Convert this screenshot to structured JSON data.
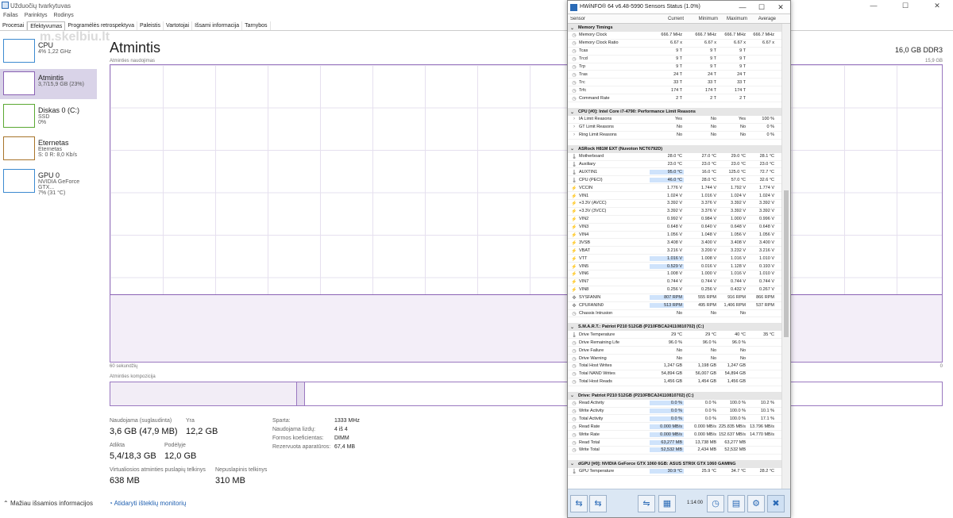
{
  "tm": {
    "title": "Užduočių tvarkytuvas",
    "win_min": "—",
    "win_max": "☐",
    "win_close": "✕",
    "menu": [
      "Failas",
      "Parinktys",
      "Rodinys"
    ],
    "tabs": [
      "Procesai",
      "Efektyvumas",
      "Programėlės retrospektyva",
      "Paleistis",
      "Vartotojai",
      "Išsami informacija",
      "Tarnybos"
    ],
    "watermark": "m.skelbiu.lt",
    "sidebar": [
      {
        "name": "CPU",
        "sub1": "4% 1,22 GHz",
        "sub2": ""
      },
      {
        "name": "Atmintis",
        "sub1": "3,7/15,9 GB (23%)",
        "sub2": ""
      },
      {
        "name": "Diskas 0 (C:)",
        "sub1": "SSD",
        "sub2": "0%"
      },
      {
        "name": "Eternetas",
        "sub1": "Eternetas",
        "sub2": "S: 0 R: 8,0 Kb/s"
      },
      {
        "name": "GPU 0",
        "sub1": "NVIDIA GeForce GTX...",
        "sub2": "7% (31 °C)"
      }
    ],
    "heading": "Atmintis",
    "mem_size": "16,0 GB DDR3",
    "chart_label": "Atminties naudojimas",
    "chart_max": "15,9 GB",
    "sec_label": "60 sekundžių",
    "zero": "0",
    "comp_label": "Atminties kompozicija",
    "stats": [
      {
        "label": "Naudojama (suglaudinta)",
        "value": "3,6 GB (47,9 MB)"
      },
      {
        "label": "Yra",
        "value": "12,2 GB"
      },
      {
        "label": "Atlikta",
        "value": "5,4/18,3 GB"
      },
      {
        "label": "Podėlyje",
        "value": "12,0 GB"
      },
      {
        "label": "Virtualiosios atminties puslapių telkinys",
        "value": "638 MB"
      },
      {
        "label": "Nepuslapinis telkinys",
        "value": "310 MB"
      }
    ],
    "kv": [
      {
        "k": "Sparta:",
        "v": "1333 MHz"
      },
      {
        "k": "Naudojama lizdų:",
        "v": "4 iš 4"
      },
      {
        "k": "Formos koeficientas:",
        "v": "DIMM"
      },
      {
        "k": "Rezervuota aparatūros:",
        "v": "67,4 MB"
      }
    ],
    "footer": {
      "less": "Mažiau išsamios informacijos",
      "monitor": "Atidaryti išteklių monitorių"
    }
  },
  "hw": {
    "title": "HWiNFO® 64 v6.48-5990 Sensors Status (1.0%)",
    "win_min": "—",
    "win_max": "☐",
    "win_close": "✕",
    "headers": [
      "Sensor",
      "Current",
      "Minimum",
      "Maximum",
      "Average"
    ],
    "groups": [
      {
        "name": "Memory Timings",
        "rows": [
          [
            "c",
            "Memory Clock",
            "666.7 MHz",
            "666.7 MHz",
            "666.7 MHz",
            "666.7 MHz",
            0
          ],
          [
            "c",
            "Memory Clock Ratio",
            "6.67 x",
            "6.67 x",
            "6.67 x",
            "6.67 x",
            0
          ],
          [
            "c",
            "Tcas",
            "9 T",
            "9 T",
            "9 T",
            "",
            0
          ],
          [
            "c",
            "Trcd",
            "9 T",
            "9 T",
            "9 T",
            "",
            0
          ],
          [
            "c",
            "Trp",
            "9 T",
            "9 T",
            "9 T",
            "",
            0
          ],
          [
            "c",
            "Tras",
            "24 T",
            "24 T",
            "24 T",
            "",
            0
          ],
          [
            "c",
            "Trc",
            "33 T",
            "33 T",
            "33 T",
            "",
            0
          ],
          [
            "c",
            "Trfc",
            "174 T",
            "174 T",
            "174 T",
            "",
            0
          ],
          [
            "c",
            "Command Rate",
            "2 T",
            "2 T",
            "2 T",
            "",
            0
          ]
        ]
      },
      {
        "name": "CPU [#0]: Intel Core i7-4790: Performance Limit Reasons",
        "rows": [
          [
            "x",
            "IA Limit Reasons",
            "Yes",
            "No",
            "Yes",
            "100 %",
            0
          ],
          [
            "x",
            "GT Limit Reasons",
            "No",
            "No",
            "No",
            "0 %",
            0
          ],
          [
            "x",
            "Ring Limit Reasons",
            "No",
            "No",
            "No",
            "0 %",
            0
          ]
        ]
      },
      {
        "name": "ASRock H81M EXT (Nuvoton NCT6792D)",
        "rows": [
          [
            "t",
            "Motherboard",
            "28.0 °C",
            "27.0 °C",
            "29.0 °C",
            "28.1 °C",
            0
          ],
          [
            "t",
            "Auxiliary",
            "23.0 °C",
            "23.0 °C",
            "23.0 °C",
            "23.0 °C",
            0
          ],
          [
            "t",
            "AUXTIN1",
            "95.0 °C",
            "16.0 °C",
            "125.0 °C",
            "72.7 °C",
            1
          ],
          [
            "t",
            "CPU (PECI)",
            "46.0 °C",
            "28.0 °C",
            "57.0 °C",
            "32.6 °C",
            1
          ],
          [
            "v",
            "VCCIN",
            "1.776 V",
            "1.744 V",
            "1.792 V",
            "1.774 V",
            0
          ],
          [
            "v",
            "VIN1",
            "1.024 V",
            "1.016 V",
            "1.024 V",
            "1.024 V",
            0
          ],
          [
            "v",
            "+3.3V (AVCC)",
            "3.392 V",
            "3.376 V",
            "3.392 V",
            "3.392 V",
            0
          ],
          [
            "v",
            "+3.3V (3VCC)",
            "3.392 V",
            "3.376 V",
            "3.392 V",
            "3.392 V",
            0
          ],
          [
            "v",
            "VIN2",
            "0.992 V",
            "0.984 V",
            "1.000 V",
            "0.996 V",
            0
          ],
          [
            "v",
            "VIN3",
            "0.648 V",
            "0.640 V",
            "0.648 V",
            "0.648 V",
            0
          ],
          [
            "v",
            "VIN4",
            "1.056 V",
            "1.048 V",
            "1.056 V",
            "1.056 V",
            0
          ],
          [
            "v",
            "3VSB",
            "3.408 V",
            "3.400 V",
            "3.408 V",
            "3.400 V",
            0
          ],
          [
            "v",
            "VBAT",
            "3.216 V",
            "3.200 V",
            "3.232 V",
            "3.216 V",
            0
          ],
          [
            "v",
            "VTT",
            "1.016 V",
            "1.008 V",
            "1.016 V",
            "1.010 V",
            1
          ],
          [
            "v",
            "VIN5",
            "0.529 V",
            "0.016 V",
            "1.128 V",
            "0.193 V",
            1
          ],
          [
            "v",
            "VIN6",
            "1.008 V",
            "1.000 V",
            "1.016 V",
            "1.010 V",
            0
          ],
          [
            "v",
            "VIN7",
            "0.744 V",
            "0.744 V",
            "0.744 V",
            "0.744 V",
            0
          ],
          [
            "v",
            "VIN8",
            "0.256 V",
            "0.256 V",
            "0.432 V",
            "0.267 V",
            0
          ],
          [
            "f",
            "SYSFANIN",
            "807 RPM",
            "555 RPM",
            "916 RPM",
            "866 RPM",
            1
          ],
          [
            "f",
            "CPUFANIN0",
            "513 RPM",
            "495 RPM",
            "1,406 RPM",
            "537 RPM",
            1
          ],
          [
            "c",
            "Chassis Intrusion",
            "No",
            "No",
            "No",
            "",
            0
          ]
        ]
      },
      {
        "name": "S.M.A.R.T.: Patriot P210 512GB (P210FBCA24110810702) (C:)",
        "rows": [
          [
            "t",
            "Drive Temperature",
            "29 °C",
            "29 °C",
            "40 °C",
            "35 °C",
            0
          ],
          [
            "c",
            "Drive Remaining Life",
            "96.0 %",
            "96.0 %",
            "96.0 %",
            "",
            0
          ],
          [
            "c",
            "Drive Failure",
            "No",
            "No",
            "No",
            "",
            0
          ],
          [
            "c",
            "Drive Warning",
            "No",
            "No",
            "No",
            "",
            0
          ],
          [
            "c",
            "Total Host Writes",
            "1,247 GB",
            "1,198 GB",
            "1,247 GB",
            "",
            0
          ],
          [
            "c",
            "Total NAND Writes",
            "54,894 GB",
            "56,007 GB",
            "54,894 GB",
            "",
            0
          ],
          [
            "c",
            "Total Host Reads",
            "1,456 GB",
            "1,454 GB",
            "1,456 GB",
            "",
            0
          ]
        ]
      },
      {
        "name": "Drive: Patriot P210 512GB (P210FBCA24110810702) (C:)",
        "rows": [
          [
            "c",
            "Read Activity",
            "0.0 %",
            "0.0 %",
            "100.0 %",
            "10.2 %",
            1
          ],
          [
            "c",
            "Write Activity",
            "0.0 %",
            "0.0 %",
            "100.0 %",
            "10.1 %",
            1
          ],
          [
            "c",
            "Total Activity",
            "0.0 %",
            "0.0 %",
            "100.0 %",
            "17.1 %",
            1
          ],
          [
            "c",
            "Read Rate",
            "0.000 MB/s",
            "0.000 MB/s",
            "225.835 MB/s",
            "13.796 MB/s",
            1
          ],
          [
            "c",
            "Write Rate",
            "0.000 MB/s",
            "0.000 MB/s",
            "152.637 MB/s",
            "14.770 MB/s",
            1
          ],
          [
            "c",
            "Read Total",
            "63,277 MB",
            "13,738 MB",
            "63,277 MB",
            "",
            1
          ],
          [
            "c",
            "Write Total",
            "52,532 MB",
            "2,434 MB",
            "52,532 MB",
            "",
            1
          ]
        ]
      },
      {
        "name": "dGPU [#0]: NVIDIA GeForce GTX 1060 6GB: ASUS STRIX GTX 1060 GAMING",
        "rows": [
          [
            "t",
            "GPU Temperature",
            "30.9 °C",
            "25.9 °C",
            "34.7 °C",
            "28.2 °C",
            1
          ]
        ]
      }
    ],
    "toolbar": {
      "time": "1:14:00",
      "b1": "⇆",
      "b2": "⇆",
      "b3": "⇋",
      "b4": "▦",
      "b5": "◷",
      "b6": "▤",
      "b7": "⚙",
      "b8": "✖"
    }
  }
}
